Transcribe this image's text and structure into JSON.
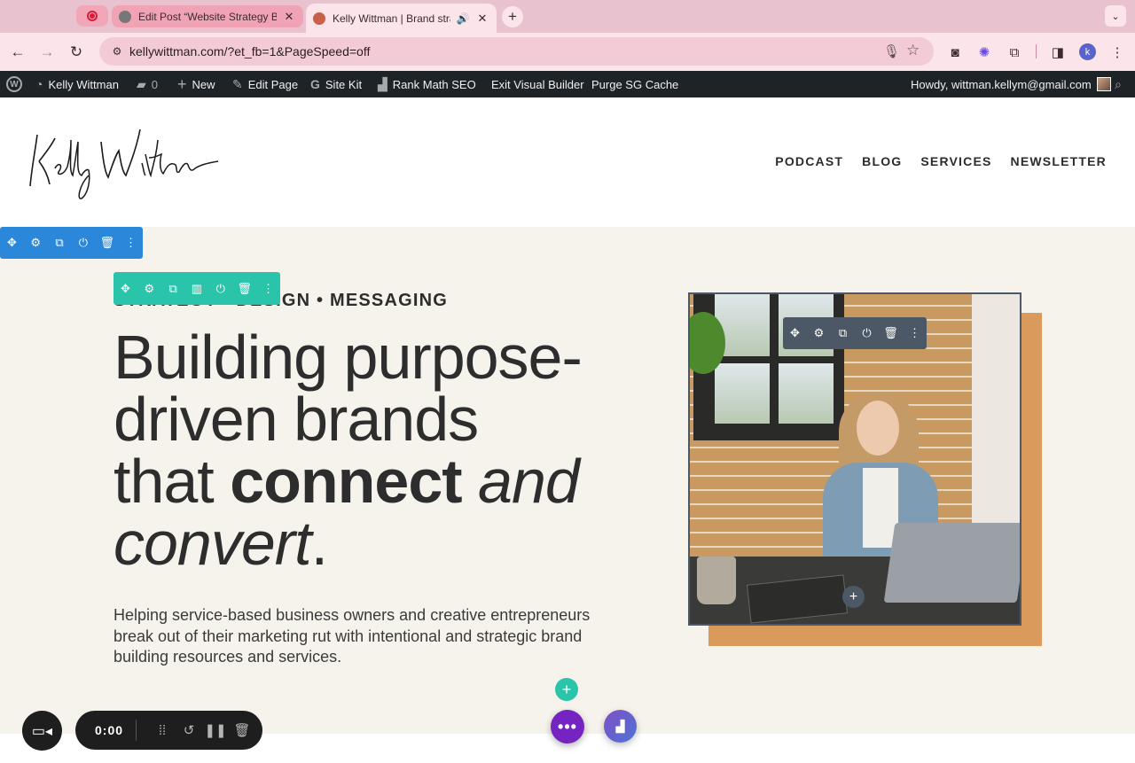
{
  "browser": {
    "tabs": [
      {
        "title": "Edit Post “Website Strategy B",
        "close": "✕"
      },
      {
        "title": "Kelly Wittman | Brand stra",
        "close": "✕",
        "audio": "🔊"
      }
    ],
    "new_tab": "+",
    "tab_menu": "⌄",
    "url": "kellywittman.com/?et_fb=1&PageSpeed=off",
    "profile_initial": "k"
  },
  "admin_bar": {
    "site_name": "Kelly Wittman",
    "comments_count": "0",
    "new_label": "New",
    "edit_page": "Edit Page",
    "site_kit": "Site Kit",
    "rank_math": "Rank Math SEO",
    "exit_builder": "Exit Visual Builder",
    "purge_cache": "Purge SG Cache",
    "howdy": "Howdy, wittman.kellym@gmail.com"
  },
  "site": {
    "logo_text": "Kelly Wittman",
    "nav": [
      "PODCAST",
      "BLOG",
      "SERVICES",
      "NEWSLETTER"
    ]
  },
  "hero": {
    "eyebrow": "STRATEGY • DESIGN • MESSAGING",
    "headline": {
      "line1": "Building purpose-",
      "line2": "driven brands",
      "line3a": "that ",
      "line3b": "connect",
      "line3c": " and",
      "line4a": "convert",
      "line4b": "."
    },
    "subtext": "Helping service-based business owners and creative entrepreneurs break out of their marketing rut with intentional and strategic brand building resources and services."
  },
  "recorder": {
    "time": "0:00"
  },
  "colors": {
    "section_bar": "#2b87da",
    "row_bar": "#29c4a9",
    "module_bar": "#4c5866",
    "photo_shadow": "#d99a5b",
    "builder_menu": "#7524c2"
  }
}
